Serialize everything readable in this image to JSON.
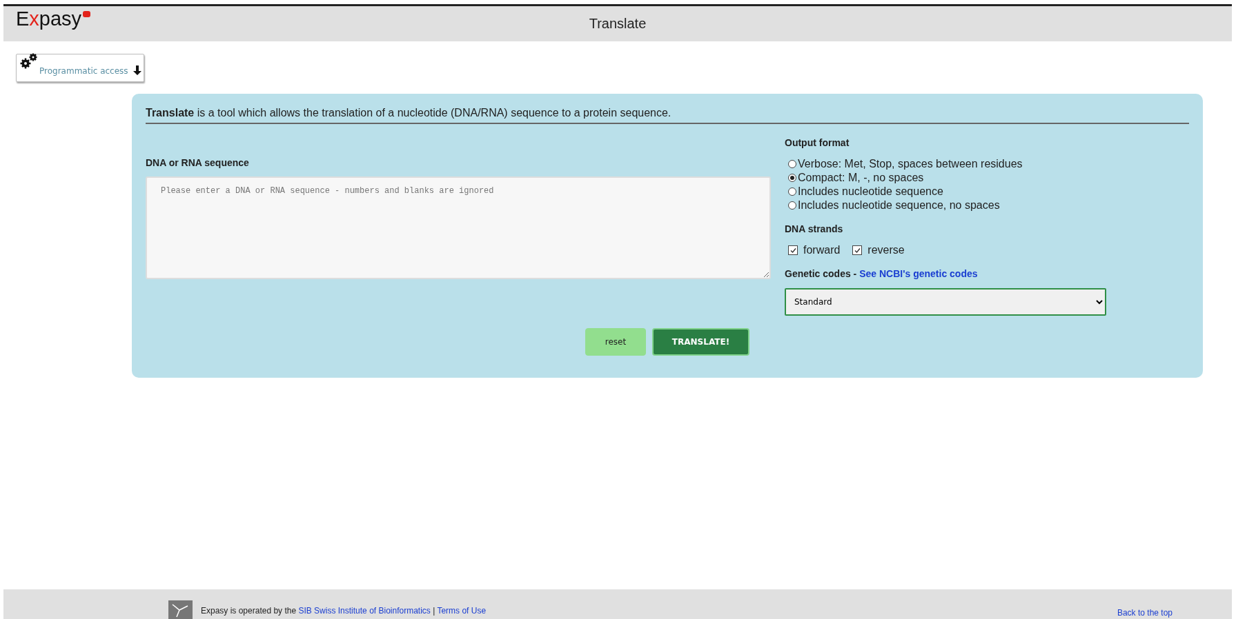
{
  "header": {
    "logo": "Expasy",
    "title": "Translate"
  },
  "programmatic_access": {
    "label": "Programmatic access"
  },
  "intro": "**Translate** is a tool which allows the translation of a nucleotide (DNA/RNA) sequence to a protein sequence.",
  "sequence": {
    "label": "DNA or RNA sequence",
    "placeholder": "Please enter a DNA or RNA sequence - numbers and blanks are ignored"
  },
  "output_format": {
    "label": "Output format",
    "options": [
      {
        "label": "Verbose: Met, Stop, spaces between residues",
        "selected": false
      },
      {
        "label": "Compact: M, -, no spaces",
        "selected": true
      },
      {
        "label": "Includes nucleotide sequence",
        "selected": false
      },
      {
        "label": "Includes nucleotide sequence, no spaces",
        "selected": false
      }
    ]
  },
  "dna_strands": {
    "label": "DNA strands",
    "options": [
      {
        "label": "forward",
        "checked": true
      },
      {
        "label": "reverse",
        "checked": true
      }
    ]
  },
  "genetic_codes": {
    "label": "Genetic codes - ",
    "link": "See NCBI's genetic codes",
    "value": "Standard"
  },
  "buttons": [
    {
      "kind": "secondary",
      "label": "reset"
    },
    {
      "kind": "primary",
      "label": "TRANSLATE!"
    }
  ],
  "footer": {
    "text": "Expasy is operated by the ",
    "link": "SIB Swiss Institute of Bioinformatics",
    "separator": "|",
    "terms": "Terms of Use",
    "back": "Back to the top"
  }
}
